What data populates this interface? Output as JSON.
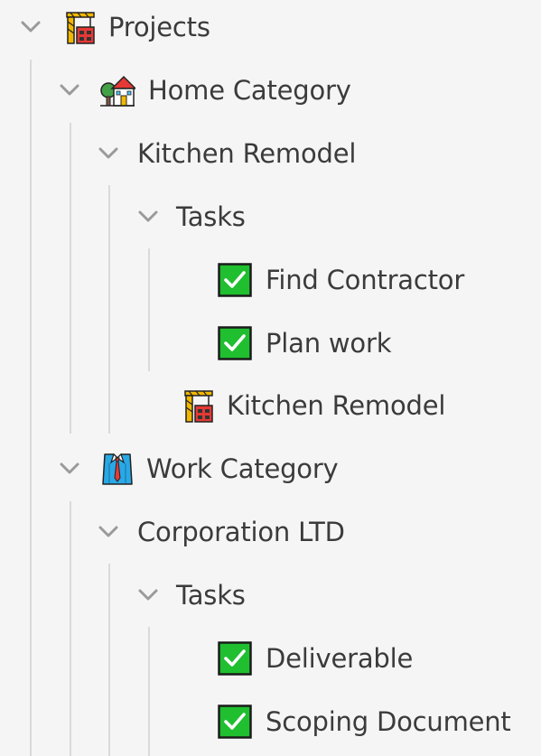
{
  "tree": {
    "projects": {
      "label": "Projects",
      "icon": "construction-crane-icon",
      "expanded": true
    },
    "home_category": {
      "label": "Home Category",
      "icon": "house-with-garden-icon",
      "expanded": true
    },
    "kitchen_remodel": {
      "label": "Kitchen Remodel",
      "expanded": true
    },
    "kitchen_tasks": {
      "label": "Tasks",
      "expanded": true,
      "items": [
        {
          "label": "Find Contractor",
          "done": true
        },
        {
          "label": "Plan work",
          "done": true
        }
      ]
    },
    "kitchen_remodel_project": {
      "label": "Kitchen Remodel",
      "icon": "construction-crane-icon"
    },
    "work_category": {
      "label": "Work Category",
      "icon": "shirt-and-tie-icon",
      "expanded": true
    },
    "corporation": {
      "label": "Corporation LTD",
      "expanded": true
    },
    "corporation_tasks": {
      "label": "Tasks",
      "expanded": true,
      "items": [
        {
          "label": "Deliverable",
          "done": true
        },
        {
          "label": "Scoping Document",
          "done": true
        }
      ]
    }
  },
  "colors": {
    "background": "#f5f5f5",
    "text": "#3b3b3b",
    "chevron": "#9a9a9a",
    "guide_line": "#dadada",
    "check_green": "#1fbf2f"
  }
}
